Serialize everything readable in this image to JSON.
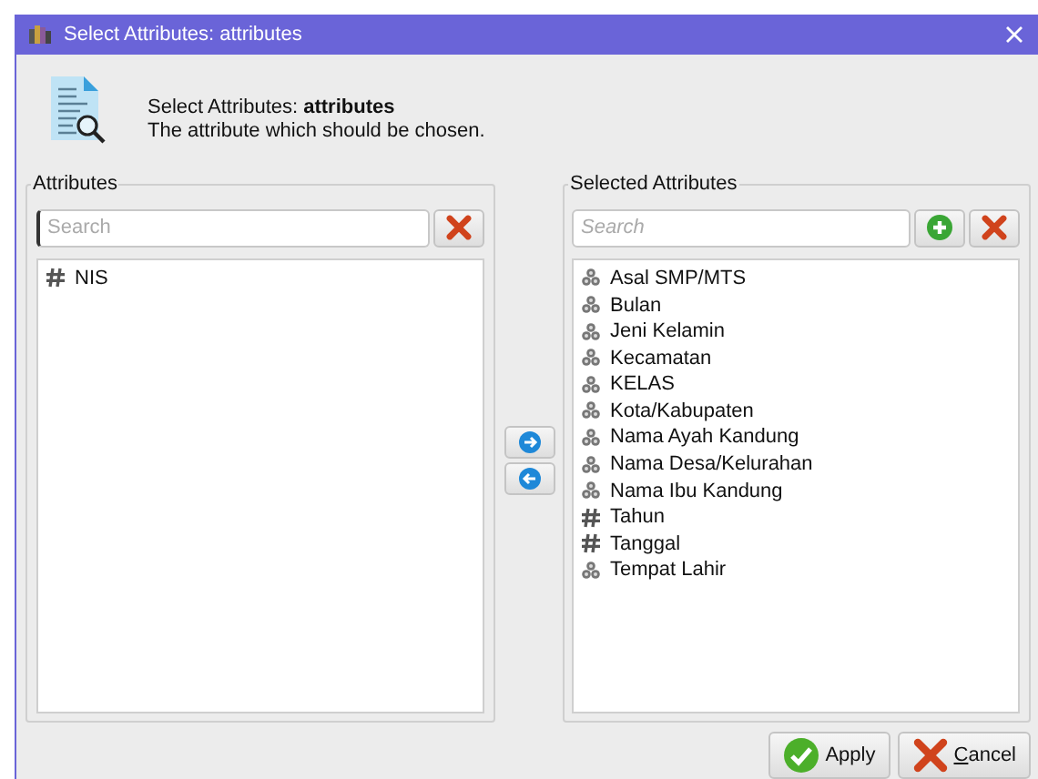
{
  "window": {
    "title": "Select Attributes: attributes"
  },
  "header": {
    "title": "Select Attributes: **attributes**",
    "description": "The attribute which should be chosen."
  },
  "attributes": {
    "label": "Attributes",
    "search": {
      "placeholder": "Search"
    },
    "items": [
      {
        "kind": "numeric",
        "name": "NIS"
      }
    ]
  },
  "selected_attributes": {
    "label": "Selected Attributes",
    "search": {
      "placeholder": "Search"
    },
    "items": [
      {
        "kind": "nominal",
        "name": "Asal SMP/MTS"
      },
      {
        "kind": "nominal",
        "name": "Bulan"
      },
      {
        "kind": "nominal",
        "name": "Jeni Kelamin"
      },
      {
        "kind": "nominal",
        "name": "Kecamatan"
      },
      {
        "kind": "nominal",
        "name": "KELAS"
      },
      {
        "kind": "nominal",
        "name": "Kota/Kabupaten"
      },
      {
        "kind": "nominal",
        "name": "Nama Ayah Kandung"
      },
      {
        "kind": "nominal",
        "name": "Nama Desa/Kelurahan"
      },
      {
        "kind": "nominal",
        "name": "Nama Ibu Kandung"
      },
      {
        "kind": "numeric",
        "name": "Tahun"
      },
      {
        "kind": "numeric",
        "name": "Tanggal"
      },
      {
        "kind": "nominal",
        "name": "Tempat Lahir"
      }
    ]
  },
  "buttons": [
    {
      "kind": "apply",
      "label": "Apply"
    },
    {
      "kind": "cancel",
      "label": "Cancel"
    }
  ]
}
